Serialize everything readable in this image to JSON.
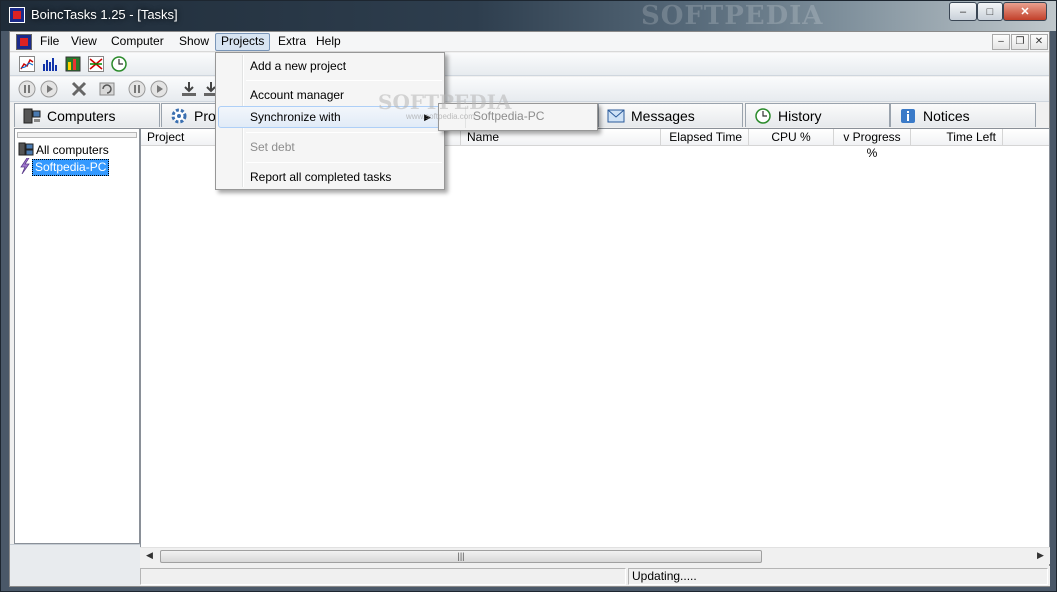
{
  "window": {
    "title": "BoincTasks 1.25 - [Tasks]",
    "watermark": "SOFTPEDIA",
    "controls": {
      "minimize": "–",
      "maximize": "□",
      "close": "✕"
    }
  },
  "menubar": {
    "items": [
      "File",
      "View",
      "Computer",
      "Show",
      "Projects",
      "Extra",
      "Help"
    ],
    "active": "Projects",
    "mdi_controls": {
      "minimize": "–",
      "restore": "❐",
      "close": "✕"
    }
  },
  "toolbar1": {
    "icons": [
      "graph-icon",
      "bar-chart-icon",
      "tasks-chart-icon",
      "transfer-chart-icon",
      "clock-refresh-icon"
    ]
  },
  "toolbar2": {
    "icons": [
      "suspend-icon",
      "resume-icon",
      "abort-icon",
      "update-icon",
      "suspend-project-icon",
      "resume-project-icon",
      "download-icon",
      "download-more-icon"
    ]
  },
  "tabs": [
    {
      "label": "Computers",
      "icon": "computers-icon"
    },
    {
      "label": "Proj",
      "icon": "projects-gear-icon"
    },
    {
      "label": "Messages",
      "icon": "envelope-icon"
    },
    {
      "label": "History",
      "icon": "history-clock-icon"
    },
    {
      "label": "Notices",
      "icon": "notice-icon"
    }
  ],
  "tree": {
    "items": [
      {
        "label": "All computers",
        "icon": "computers-group-icon"
      },
      {
        "label": "Softpedia-PC",
        "icon": "computer-lightning-icon",
        "selected": true
      }
    ]
  },
  "columns": [
    "Project",
    "Name",
    "Elapsed Time",
    "CPU %",
    "v Progress %",
    "Time Left"
  ],
  "status": {
    "text": "Updating....."
  },
  "scrollbar": {
    "grip": "|||",
    "left_arrow": "◀",
    "right_arrow": "▶"
  },
  "projects_menu": {
    "items": [
      {
        "label": "Add a new project",
        "enabled": true
      },
      {
        "label": "Account manager",
        "enabled": true
      },
      {
        "label": "Synchronize with",
        "enabled": true,
        "submenu": true
      },
      {
        "label": "Set debt",
        "enabled": false
      },
      {
        "label": "Report all completed tasks",
        "enabled": true
      }
    ],
    "submenu_arrow": "▶"
  },
  "synchronize_submenu": {
    "items": [
      "Softpedia-PC"
    ],
    "watermark": "SOFTPEDIA",
    "watermark_small": "www.softpedia.com"
  }
}
